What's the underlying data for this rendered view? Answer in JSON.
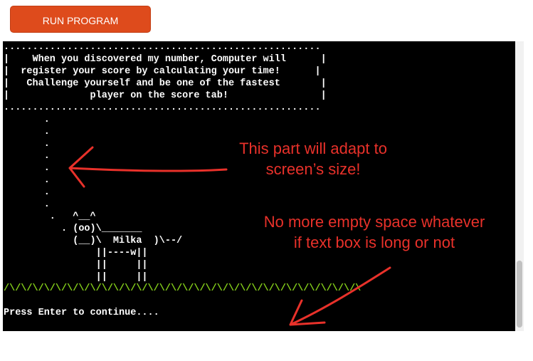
{
  "toolbar": {
    "run_label": "RUN PROGRAM",
    "run_color": "#de4b1c"
  },
  "terminal": {
    "background": "#000000",
    "banner_and_cow": ".......................................................\n|    When you discovered my number, Computer will      |\n|  register your score by calculating your time!      |\n|   Challenge yourself and be one of the fastest       |\n|              player on the score tab!                |\n.......................................................\n       .\n       .\n       .\n       .\n       .\n       .\n       .\n       .\n        .   ^__^\n          . (oo)\\_______\n            (__)\\  Milka  )\\--/\n                ||----w||\n                ||     ||\n                ||     ||",
    "grass": "/\\/\\/\\/\\/\\/\\/\\/\\/\\/\\/\\/\\/\\/\\/\\/\\/\\/\\/\\/\\/\\/\\/\\/\\/\\/\\/\\/\\/\\/\\/\\",
    "grass_color": "#86d11a",
    "prompt": "Press Enter to continue...."
  },
  "annotations": {
    "adapt_line1": "This part will adapt to",
    "adapt_line2": "screen’s size!",
    "space_line1": "No more empty space whatever",
    "space_line2": "if text box is long or not",
    "color": "#e8312a"
  }
}
